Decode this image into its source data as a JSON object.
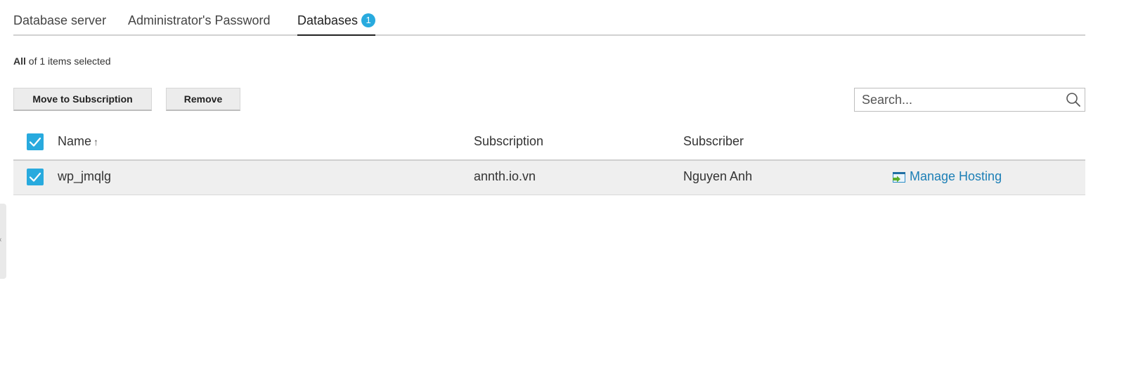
{
  "tabs": [
    {
      "label": "Database server"
    },
    {
      "label": "Administrator's Password"
    },
    {
      "label": "Databases",
      "badge": "1",
      "active": true
    }
  ],
  "selection": {
    "prefix": "All",
    "suffix": " of 1 items selected"
  },
  "toolbar": {
    "move_label": "Move to Subscription",
    "remove_label": "Remove"
  },
  "search": {
    "placeholder": "Search..."
  },
  "table": {
    "columns": {
      "name": "Name",
      "subscription": "Subscription",
      "subscriber": "Subscriber"
    },
    "sort_indicator": "↑",
    "rows": [
      {
        "checked": true,
        "name": "wp_jmqlg",
        "subscription": "annth.io.vn",
        "subscriber": "Nguyen Anh",
        "action": "Manage Hosting"
      }
    ]
  },
  "colors": {
    "accent": "#28aade",
    "link": "#1c7fb6",
    "row_bg": "#efefef"
  },
  "icons": {
    "search": "search-icon",
    "checkbox": "checkmark-icon",
    "manage": "manage-hosting-icon",
    "sort": "sort-ascending-icon"
  }
}
